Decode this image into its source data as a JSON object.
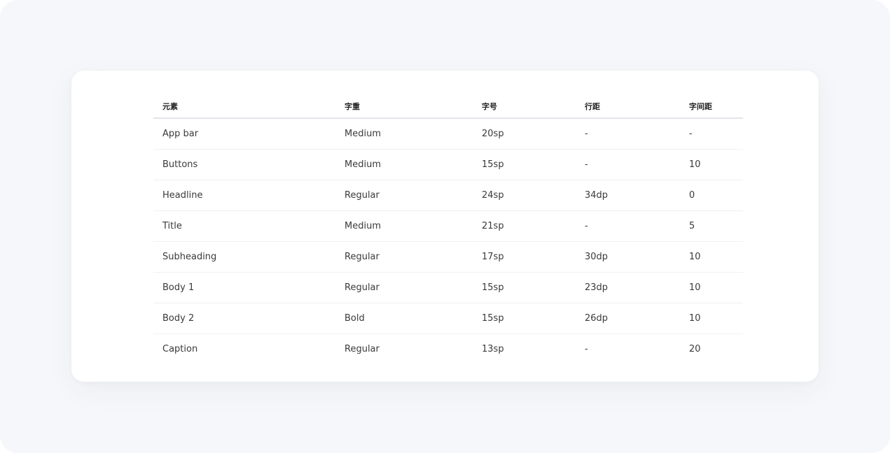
{
  "table": {
    "headers": [
      "元素",
      "字重",
      "字号",
      "行距",
      "字间距"
    ],
    "rows": [
      [
        "App bar",
        "Medium",
        "20sp",
        "-",
        "-"
      ],
      [
        "Buttons",
        "Medium",
        "15sp",
        "-",
        "10"
      ],
      [
        "Headline",
        "Regular",
        "24sp",
        "34dp",
        "0"
      ],
      [
        "Title",
        "Medium",
        "21sp",
        "-",
        "5"
      ],
      [
        "Subheading",
        "Regular",
        "17sp",
        "30dp",
        "10"
      ],
      [
        "Body 1",
        "Regular",
        "15sp",
        "23dp",
        "10"
      ],
      [
        "Body 2",
        "Bold",
        "15sp",
        "26dp",
        "10"
      ],
      [
        "Caption",
        "Regular",
        "13sp",
        "-",
        "20"
      ]
    ]
  },
  "colors": {
    "page_background": "#f6f7fa",
    "card_background": "#ffffff",
    "header_text": "#222222",
    "body_text": "#3a3a3a",
    "divider": "#eef0f3"
  }
}
